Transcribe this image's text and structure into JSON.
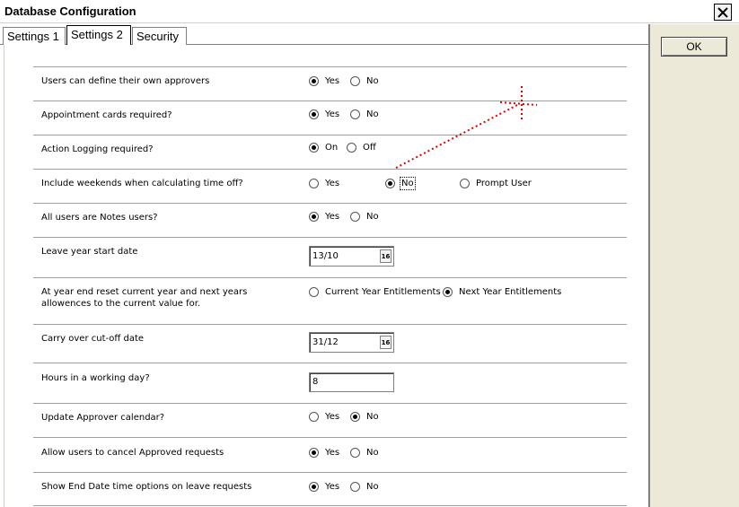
{
  "window": {
    "title": "Database Configuration",
    "ok_label": "OK"
  },
  "tabs": [
    {
      "label": "Settings 1"
    },
    {
      "label": "Settings 2"
    },
    {
      "label": "Security"
    }
  ],
  "rows": [
    {
      "label": "Users can define their own approvers",
      "options": [
        "Yes",
        "No"
      ],
      "selected": "Yes"
    },
    {
      "label": "Appointment cards required?",
      "options": [
        "Yes",
        "No"
      ],
      "selected": "Yes"
    },
    {
      "label": "Action Logging required?",
      "options": [
        "On",
        "Off"
      ],
      "selected": "On"
    },
    {
      "label": "Include weekends when calculating time off?",
      "options": [
        "Yes",
        "No",
        "Prompt User"
      ],
      "selected": "No"
    },
    {
      "label": "All users are Notes users?",
      "options": [
        "Yes",
        "No"
      ],
      "selected": "Yes"
    },
    {
      "label": "Leave year start date",
      "value": "13/10",
      "calendar_icon_text": "16"
    },
    {
      "label_line1": "At year end reset current year and next years",
      "label_line2": "allowences to the current value for.",
      "options": [
        "Current Year Entitlements",
        "Next Year Entitlements"
      ],
      "selected": "Next Year Entitlements"
    },
    {
      "label": "Carry over cut-off date",
      "value": "31/12",
      "calendar_icon_text": "16"
    },
    {
      "label": "Hours in a working day?",
      "value": "8"
    },
    {
      "label": "Update Approver calendar?",
      "options": [
        "Yes",
        "No"
      ],
      "selected": "No"
    },
    {
      "label": "Allow users to cancel Approved requests",
      "options": [
        "Yes",
        "No"
      ],
      "selected": "Yes"
    },
    {
      "label": "Show End Date time options on leave requests",
      "options": [
        "Yes",
        "No"
      ],
      "selected": "Yes"
    }
  ],
  "icons": {
    "close": "close-icon",
    "calendar": "calendar-icon",
    "cursor": "crosshair-annotation-icon"
  },
  "colors": {
    "annotation": "#e00000",
    "sidebar": "#ece9d8"
  }
}
